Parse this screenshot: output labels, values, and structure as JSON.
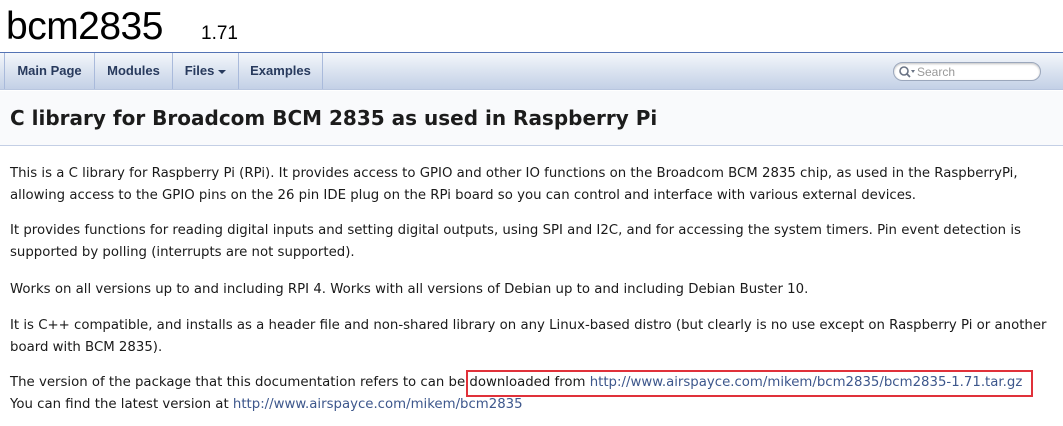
{
  "project": {
    "name": "bcm2835",
    "number": "1.71"
  },
  "nav": {
    "items": [
      {
        "label": "Main Page"
      },
      {
        "label": "Modules"
      },
      {
        "label": "Files"
      },
      {
        "label": "Examples"
      }
    ],
    "search_placeholder": "Search"
  },
  "header": {
    "title": "C library for Broadcom BCM 2835 as used in Raspberry Pi"
  },
  "content": {
    "p1": "This is a C library for Raspberry Pi (RPi). It provides access to GPIO and other IO functions on the Broadcom BCM 2835 chip, as used in the RaspberryPi, allowing access to the GPIO pins on the 26 pin IDE plug on the RPi board so you can control and interface with various external devices.",
    "p2": "It provides functions for reading digital inputs and setting digital outputs, using SPI and I2C, and for accessing the system timers. Pin event detection is supported by polling (interrupts are not supported).",
    "p3": "Works on all versions up to and including RPI 4. Works with all versions of Debian up to and including Debian Buster 10.",
    "p4": "It is C++ compatible, and installs as a header file and non-shared library on any Linux-based distro (but clearly is no use except on Raspberry Pi or another board with BCM 2835).",
    "p5_text": "The version of the package that this documentation refers to can be ",
    "p5_dl": "downloaded from ",
    "p5_link": "http://www.airspayce.com/mikem/bcm2835/bcm2835-1.71.tar.gz",
    "p6_text": "You can find the latest version at ",
    "p6_link": "http://www.airspayce.com/mikem/bcm2835"
  },
  "colors": {
    "link": "#3d578c",
    "highlight": "#e0313a",
    "nav_text": "#283a5d"
  },
  "icons": {
    "search": "magnifier-icon"
  }
}
